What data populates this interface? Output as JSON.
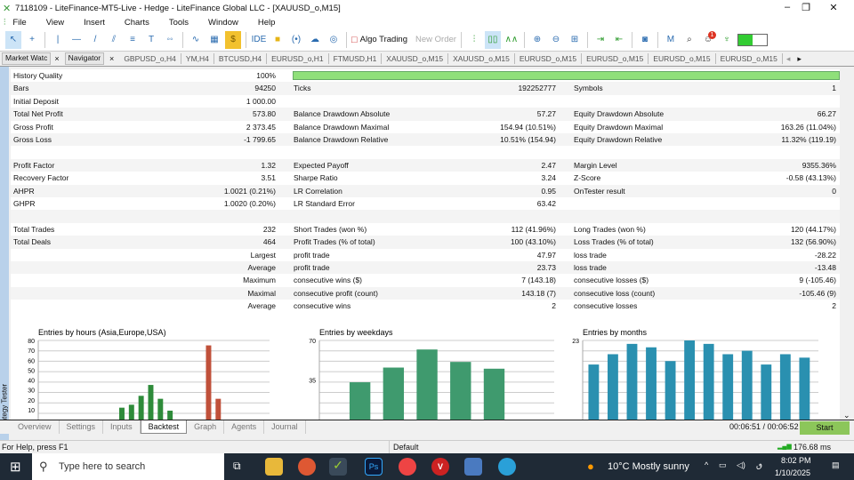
{
  "window": {
    "title": "7118109 - LiteFinance-MT5-Live - Hedge - LiteFinance Global LLC - [XAUUSD_o,M15]"
  },
  "menu": [
    "File",
    "View",
    "Insert",
    "Charts",
    "Tools",
    "Window",
    "Help"
  ],
  "toolbar": {
    "ide": "IDE",
    "algo_trading": "Algo Trading",
    "new_order": "New Order",
    "m": "M",
    "notif_count": "1"
  },
  "panel_tabs": [
    "Market Watc",
    "Navigator"
  ],
  "chart_tabs": [
    "GBPUSD_o,H4",
    "YM,H4",
    "BTCUSD,H4",
    "EURUSD_o,H1",
    "FTMUSD,H1",
    "XAUUSD_o,M15",
    "XAUUSD_o,M15",
    "EURUSD_o,M15",
    "EURUSD_o,M15",
    "EURUSD_o,M15",
    "EURUSD_o,M15"
  ],
  "report": {
    "history_quality_label": "History Quality",
    "history_quality": "100%",
    "history_quality_fraction": 1.0,
    "rows": [
      [
        "Bars",
        "94250",
        "Ticks",
        "192252777",
        "Symbols",
        "1"
      ],
      [
        "Initial Deposit",
        "1 000.00",
        "",
        "",
        "",
        ""
      ],
      [
        "Total Net Profit",
        "573.80",
        "Balance Drawdown Absolute",
        "57.27",
        "Equity Drawdown Absolute",
        "66.27"
      ],
      [
        "Gross Profit",
        "2 373.45",
        "Balance Drawdown Maximal",
        "154.94 (10.51%)",
        "Equity Drawdown Maximal",
        "163.26 (11.04%)"
      ],
      [
        "Gross Loss",
        "-1 799.65",
        "Balance Drawdown Relative",
        "10.51% (154.94)",
        "Equity Drawdown Relative",
        "11.32% (119.19)"
      ],
      [
        "",
        "",
        "",
        "",
        "",
        ""
      ],
      [
        "Profit Factor",
        "1.32",
        "Expected Payoff",
        "2.47",
        "Margin Level",
        "9355.36%"
      ],
      [
        "Recovery Factor",
        "3.51",
        "Sharpe Ratio",
        "3.24",
        "Z-Score",
        "-0.58 (43.13%)"
      ],
      [
        "AHPR",
        "1.0021 (0.21%)",
        "LR Correlation",
        "0.95",
        "OnTester result",
        "0"
      ],
      [
        "GHPR",
        "1.0020 (0.20%)",
        "LR Standard Error",
        "63.42",
        "",
        ""
      ],
      [
        "",
        "",
        "",
        "",
        "",
        ""
      ],
      [
        "Total Trades",
        "232",
        "Short Trades (won %)",
        "112 (41.96%)",
        "Long Trades (won %)",
        "120 (44.17%)"
      ],
      [
        "Total Deals",
        "464",
        "Profit Trades (% of total)",
        "100 (43.10%)",
        "Loss Trades (% of total)",
        "132 (56.90%)"
      ],
      [
        "",
        "Largest",
        "profit trade",
        "47.97",
        "loss trade",
        "-28.22"
      ],
      [
        "",
        "Average",
        "profit trade",
        "23.73",
        "loss trade",
        "-13.48"
      ],
      [
        "",
        "Maximum",
        "consecutive wins ($)",
        "7 (143.18)",
        "consecutive losses ($)",
        "9 (-105.46)"
      ],
      [
        "",
        "Maximal",
        "consecutive profit (count)",
        "143.18 (7)",
        "consecutive loss (count)",
        "-105.46 (9)"
      ],
      [
        "",
        "Average",
        "consecutive wins",
        "2",
        "consecutive losses",
        "2"
      ]
    ]
  },
  "chart_data": [
    {
      "type": "bar",
      "title": "Entries by hours (Asia,Europe,USA)",
      "ylim": [
        0,
        80
      ],
      "yticks": [
        "10",
        "20",
        "30",
        "40",
        "50",
        "60",
        "70",
        "80"
      ],
      "x": [
        8,
        9,
        10,
        11,
        12,
        13,
        17,
        18
      ],
      "values": [
        12,
        15,
        24,
        35,
        21,
        9,
        75,
        21
      ],
      "colors": [
        "#2e8b3a",
        "#2e8b3a",
        "#2e8b3a",
        "#2e8b3a",
        "#2e8b3a",
        "#2e8b3a",
        "#c0503a",
        "#c0503a"
      ]
    },
    {
      "type": "bar",
      "title": "Entries by weekdays",
      "ylim": [
        0,
        70
      ],
      "yticks": [
        "35",
        "70"
      ],
      "values": [
        33,
        46,
        62,
        51,
        45
      ],
      "color": "#3f9a6e"
    },
    {
      "type": "bar",
      "title": "Entries by months",
      "ylim": [
        0,
        23
      ],
      "yticks": [
        "23"
      ],
      "values": [
        16,
        19,
        22,
        21,
        17,
        23,
        22,
        19,
        20,
        16,
        19,
        18
      ],
      "color": "#2a90b0"
    }
  ],
  "bottom_tabs": [
    "Overview",
    "Settings",
    "Inputs",
    "Backtest",
    "Graph",
    "Agents",
    "Journal"
  ],
  "tester": {
    "side_label": "Strategy Tester",
    "time": "00:06:51 / 00:06:52",
    "start": "Start"
  },
  "status": {
    "help": "For Help, press F1",
    "profile": "Default",
    "ping": "176.68 ms"
  },
  "taskbar": {
    "search": "Type here to search",
    "weather": "10°C  Mostly sunny",
    "time": "8:02 PM",
    "date": "1/10/2025",
    "lang": "ٯ"
  },
  "colors": {
    "quality_bar": "#8fe07a",
    "start_button": "#8cc65a"
  }
}
